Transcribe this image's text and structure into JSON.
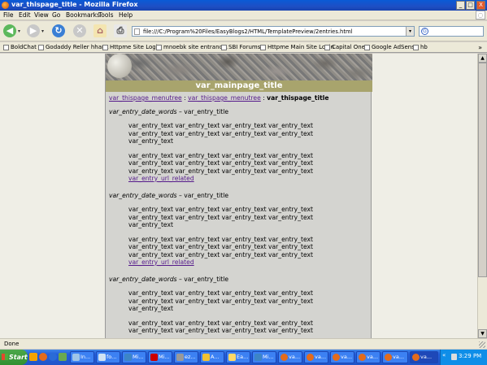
{
  "window": {
    "title": "var_thispage_title - Mozilla Firefox",
    "controls": [
      "_",
      "□",
      "X"
    ]
  },
  "menu": [
    "File",
    "Edit",
    "View",
    "Go",
    "Bookmarks",
    "Tools",
    "Help"
  ],
  "nav": {
    "url": "file:///C:/Program%20Files/EasyBlogs2/HTML/TemplatePreview/2entries.html",
    "search_value": ""
  },
  "bookmarks": [
    "BoldChat",
    "Godaddy Reller hhar...",
    "Httpme Site Login",
    "mnoebk site entranc...",
    "SBI Forums",
    "Httpme Main Site Login",
    "Capital One",
    "Google AdSense",
    "hb"
  ],
  "bookmarks_more": "»",
  "page": {
    "main_title": "var_mainpage_title",
    "breadcrumb": {
      "link1": "var_thispage_menutree",
      "sep1": ":",
      "link2": "var_thispage_menutree",
      "sep2": ":",
      "current": "var_thispage_title"
    },
    "entries": [
      {
        "date": "var_entry_date_words",
        "dash": " – ",
        "title": "var_entry_title",
        "para1": "var_entry_text var_entry_text var_entry_text var_entry_text var_entry_text var_entry_text var_entry_text var_entry_text var_entry_text",
        "para2": "var_entry_text var_entry_text var_entry_text var_entry_text var_entry_text var_entry_text var_entry_text var_entry_text var_entry_text var_entry_text var_entry_text var_entry_text",
        "link": "var_entry_url_related"
      },
      {
        "date": "var_entry_date_words",
        "dash": " – ",
        "title": "var_entry_title",
        "para1": "var_entry_text var_entry_text var_entry_text var_entry_text var_entry_text var_entry_text var_entry_text var_entry_text var_entry_text",
        "para2": "var_entry_text var_entry_text var_entry_text var_entry_text var_entry_text var_entry_text var_entry_text var_entry_text var_entry_text var_entry_text var_entry_text var_entry_text",
        "link": "var_entry_url_related"
      },
      {
        "date": "var_entry_date_words",
        "dash": " – ",
        "title": "var_entry_title",
        "para1": "var_entry_text var_entry_text var_entry_text var_entry_text var_entry_text var_entry_text var_entry_text var_entry_text var_entry_text",
        "para2": "var_entry_text var_entry_text var_entry_text var_entry_text var_entry_text var_entry_text var_entry_text var_entry_text"
      }
    ]
  },
  "status": "Done",
  "taskbar": {
    "start": "Start",
    "buttons": [
      "In...",
      "fo...",
      "Mi...",
      "Mi...",
      "ez...",
      "A...",
      "Ea...",
      "Mi...",
      "va...",
      "va...",
      "va...",
      "va...",
      "va...",
      "va..."
    ],
    "tray_chevron": "«",
    "clock": "3:29 PM"
  },
  "colors": {
    "titlebar": "#1e4fc4",
    "banner_band": "#a8a46d",
    "link_visited": "#551a8b",
    "taskbar": "#245edb",
    "start": "#2f8f2f"
  }
}
